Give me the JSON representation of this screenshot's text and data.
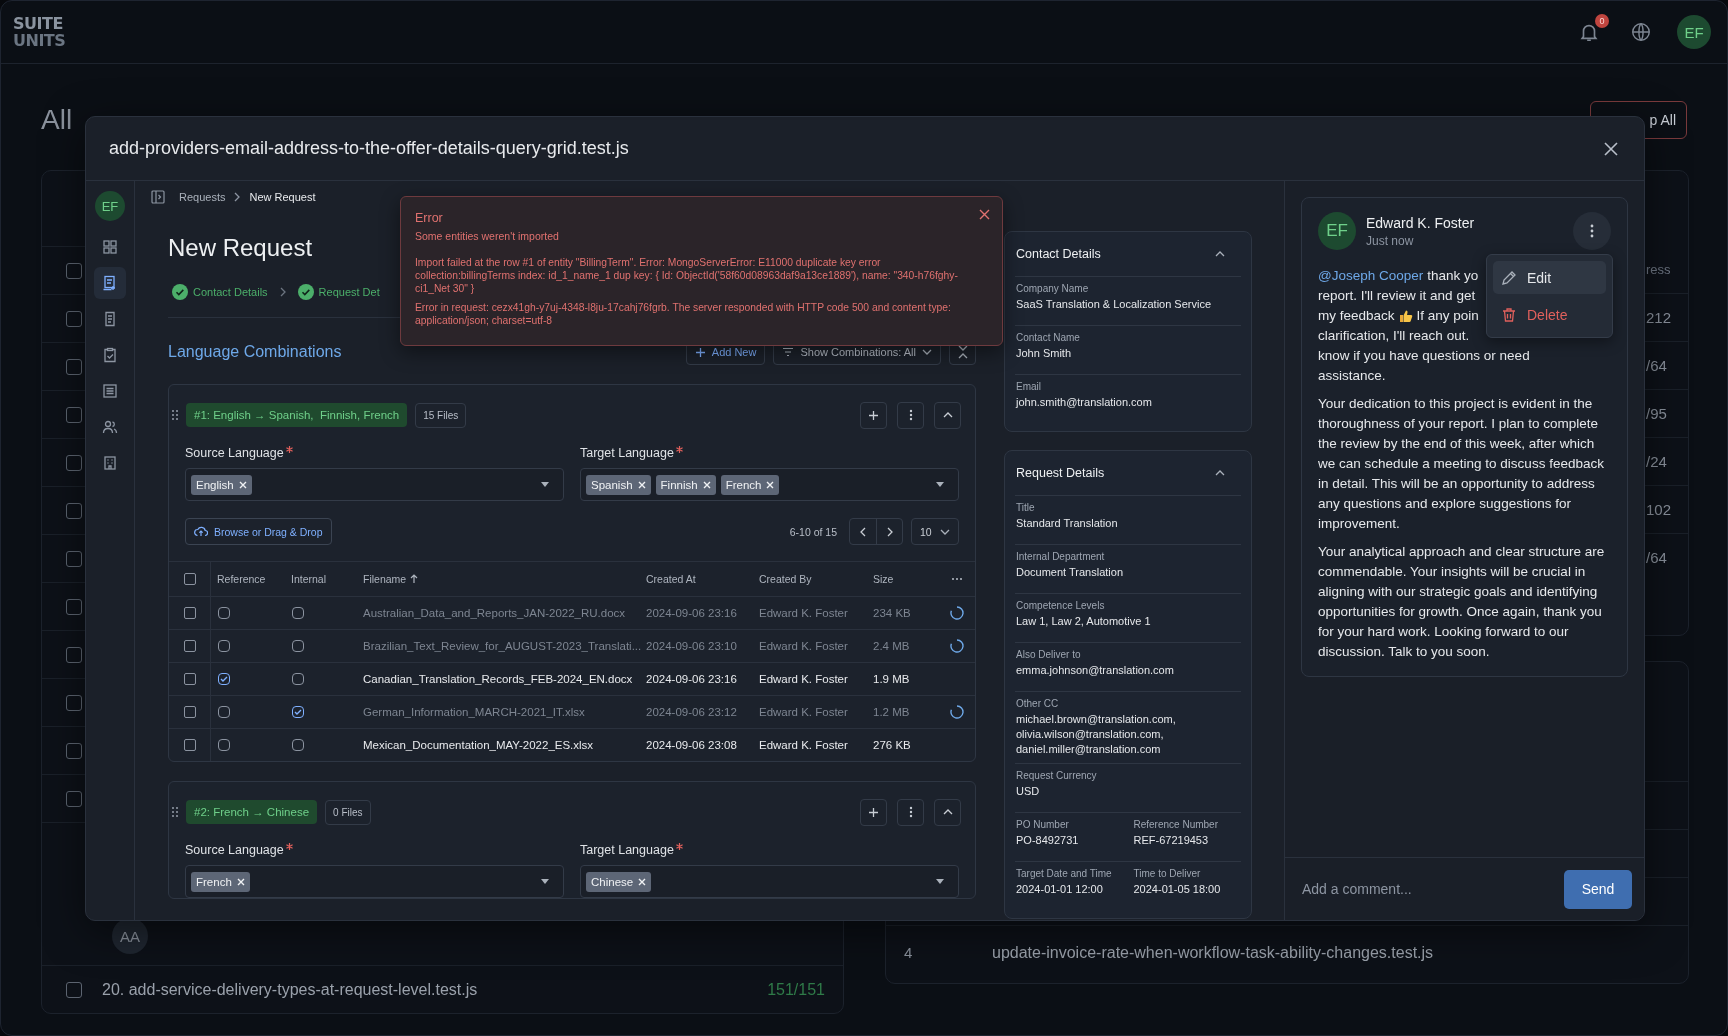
{
  "app": {
    "logo_lines": [
      "SUITE",
      "UNITS"
    ],
    "notification_count": "0",
    "user_initials": "EF"
  },
  "background": {
    "title": "All",
    "stop_button": "p All",
    "left_rows": [
      {
        "checked": false
      },
      {
        "checked": false
      },
      {
        "checked": false
      },
      {
        "checked": false
      },
      {
        "checked": false
      },
      {
        "checked": false
      },
      {
        "checked": false
      },
      {
        "checked": false
      },
      {
        "checked": false
      },
      {
        "checked": false
      },
      {
        "checked": false
      },
      {
        "checked": false
      }
    ],
    "assignee_initials": "AA",
    "list_rows": [
      {
        "checked": false,
        "name": "20. add-service-delivery-types-at-request-level.test.js",
        "count": "151/151"
      }
    ],
    "right_header": "ress",
    "right_values": [
      "212",
      "/64",
      "/95",
      "/24",
      "102",
      "/64"
    ],
    "right_rows": [
      {
        "index": "4",
        "name": "update-invoice-rate-when-workflow-task-ability-changes.test.js"
      }
    ]
  },
  "modal": {
    "title": "add-providers-email-address-to-the-offer-details-query-grid.test.js",
    "rail": {
      "initials": "EF",
      "items": [
        {
          "kind": "dashboard",
          "selected": false
        },
        {
          "kind": "new-request",
          "selected": true
        },
        {
          "kind": "document",
          "selected": false
        },
        {
          "kind": "clipboard",
          "selected": false
        },
        {
          "kind": "list",
          "selected": false
        },
        {
          "kind": "people",
          "selected": false
        },
        {
          "kind": "building",
          "selected": false
        }
      ]
    },
    "breadcrumb": [
      "Requests",
      "New Request"
    ],
    "page_title": "New Request",
    "steps": [
      {
        "label": "Contact Details",
        "done": true
      },
      {
        "label": "Request Det",
        "done": true
      }
    ],
    "error": {
      "title": "Error",
      "subtitle": "Some entities weren't imported",
      "messages": [
        "Import failed at the row #1 of entity \"BillingTerm\". Error: MongoServerError: E11000 duplicate key error collection:billingTerms index: id_1_name_1 dup key: { Id: ObjectId('58f60d08963daf9a13ce1889'), name: \"340-h76fghy-ci1_Net 30\" }",
        "Error in request: cezx41gh-y7uj-4348-l8ju-17cahj76fgrb. The server responded with HTTP code 500 and content type: application/json; charset=utf-8"
      ]
    },
    "combinations": {
      "title": "Language Combinations",
      "add_button": "Add New",
      "filter_button": "Show Combinations: All",
      "items": [
        {
          "tag": "#1: English → Spanish,  Finnish, French",
          "files": "15 Files",
          "expanded": true,
          "source_label": "Source Language",
          "source_required": true,
          "source": [
            "English"
          ],
          "target_label": "Target Language",
          "target_required": true,
          "targets": [
            "Spanish",
            "Finnish",
            "French"
          ],
          "upload_button": "Browse or Drag & Drop",
          "pagination": {
            "range": "6-10 of 15",
            "page_size": "10"
          },
          "table": {
            "all_selected": false,
            "columns": [
              {
                "label": "Reference",
                "sorted": false
              },
              {
                "label": "Internal",
                "sorted": false
              },
              {
                "label": "Filename",
                "sorted": true
              },
              {
                "label": "Created At",
                "sorted": false
              },
              {
                "label": "Created By",
                "sorted": false
              },
              {
                "label": "Size",
                "sorted": false
              }
            ],
            "rows": [
              {
                "selected": false,
                "reference": false,
                "internal": false,
                "filename": "Australian_Data_and_Reports_JAN-2022_RU.docx",
                "created_at": "2024-09-06 23:16",
                "created_by": "Edward K. Foster",
                "size": "234 KB",
                "uploading": true
              },
              {
                "selected": false,
                "reference": false,
                "internal": false,
                "filename": "Brazilian_Text_Review_for_AUGUST-2023_Translati...",
                "created_at": "2024-09-06 23:10",
                "created_by": "Edward K. Foster",
                "size": "2.4 MB",
                "uploading": true
              },
              {
                "selected": false,
                "reference": true,
                "internal": false,
                "filename": "Canadian_Translation_Records_FEB-2024_EN.docx",
                "created_at": "2024-09-06 23:16",
                "created_by": "Edward K. Foster",
                "size": "1.9 MB",
                "uploading": false
              },
              {
                "selected": false,
                "reference": false,
                "internal": true,
                "filename": "German_Information_MARCH-2021_IT.xlsx",
                "created_at": "2024-09-06 23:12",
                "created_by": "Edward K. Foster",
                "size": "1.2 MB",
                "uploading": true
              },
              {
                "selected": false,
                "reference": false,
                "internal": false,
                "filename": "Mexican_Documentation_MAY-2022_ES.xlsx",
                "created_at": "2024-09-06 23:08",
                "created_by": "Edward K. Foster",
                "size": "276 KB",
                "uploading": false
              }
            ]
          }
        },
        {
          "tag": "#2: French → Chinese",
          "files": "0 Files",
          "expanded": true,
          "source_label": "Source Language",
          "source_required": true,
          "source": [
            "French"
          ],
          "target_label": "Target Language",
          "target_required": true,
          "targets": [
            "Chinese"
          ]
        }
      ]
    },
    "details": [
      {
        "title": "Contact Details",
        "expanded": true,
        "rows": [
          [
            {
              "label": "Company Name",
              "value": "SaaS Translation & Localization Service"
            }
          ],
          [
            {
              "label": "Contact Name",
              "value": "John Smith"
            }
          ],
          [
            {
              "label": "Email",
              "value": "john.smith@translation.com"
            }
          ]
        ]
      },
      {
        "title": "Request Details",
        "expanded": true,
        "rows": [
          [
            {
              "label": "Title",
              "value": "Standard Translation"
            }
          ],
          [
            {
              "label": "Internal Department",
              "value": "Document Translation"
            }
          ],
          [
            {
              "label": "Competence Levels",
              "value": "Law 1, Law 2, Automotive 1"
            }
          ],
          [
            {
              "label": "Also Deliver to",
              "value": "emma.johnson@translation.com"
            }
          ],
          [
            {
              "label": "Other CC",
              "value": "michael.brown@translation.com, olivia.wilson@translation.com, daniel.miller@translation.com"
            }
          ],
          [
            {
              "label": "Request Currency",
              "value": "USD"
            }
          ],
          [
            {
              "label": "PO Number",
              "value": "PO-8492731"
            },
            {
              "label": "Reference Number",
              "value": "REF-67219453"
            }
          ],
          [
            {
              "label": "Target Date and Time",
              "value": "2024-01-01 12:00"
            },
            {
              "label": "Time to Deliver",
              "value": "2024-01-05 18:00"
            }
          ]
        ]
      }
    ],
    "comment": {
      "initials": "EF",
      "author": "Edward K. Foster",
      "time": "Just now",
      "menu": {
        "open": true,
        "items": [
          {
            "kind": "edit",
            "label": "Edit",
            "highlighted": true
          },
          {
            "kind": "delete",
            "label": "Delete",
            "highlighted": false
          }
        ]
      },
      "paragraphs": [
        {
          "kind": "lines",
          "lines": [
            [
              {
                "kind": "mention",
                "text": "@Joseph Cooper"
              },
              {
                "kind": "text",
                "text": "thank yo"
              }
            ],
            [
              {
                "kind": "text",
                "text": "report. I'll review it and get"
              }
            ],
            [
              {
                "kind": "text",
                "text": "my feedback"
              },
              {
                "kind": "emoji"
              },
              {
                "kind": "text",
                "text": "If any poin"
              }
            ],
            [
              {
                "kind": "text",
                "text": "clarification, I'll reach out."
              }
            ],
            [
              {
                "kind": "text",
                "text": "know if you have questions or need"
              }
            ],
            [
              {
                "kind": "text",
                "text": "assistance."
              }
            ]
          ]
        },
        {
          "kind": "text",
          "text": "Your dedication to this project is evident in the thoroughness of your report. I plan to complete the review by the end of this week, after which we can schedule a meeting to discuss feedback in detail. This will be an opportunity to address any questions and explore suggestions for improvement."
        },
        {
          "kind": "text",
          "text": "Your analytical approach and clear structure are commendable. Your insights will be crucial in aligning with our strategic goals and identifying opportunities for growth. Once again, thank you for your hard work. Looking forward to our discussion. Talk to you soon."
        }
      ]
    },
    "composer": {
      "placeholder": "Add a comment...",
      "send": "Send"
    }
  }
}
